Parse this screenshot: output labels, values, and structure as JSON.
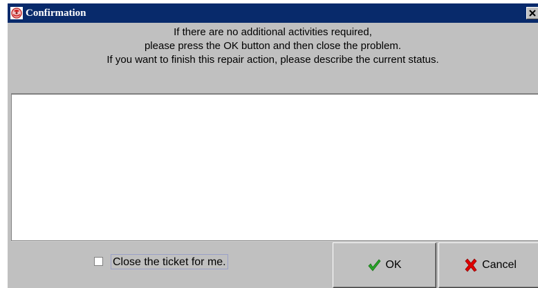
{
  "window": {
    "title": "Confirmation",
    "title_bar_color": "#0a246a",
    "background_color": "#c0c0c0",
    "app_icon": "app-logo-icon",
    "close_icon": "close-icon"
  },
  "message": {
    "line1": "If there are no additional activities required,",
    "line2": "please press the OK button and then close the problem.",
    "line3": "If you want to finish this repair action, please describe the current status."
  },
  "status_field": {
    "value": "",
    "placeholder": ""
  },
  "close_ticket": {
    "label": "Close the ticket for me.",
    "checked": false
  },
  "buttons": {
    "ok": {
      "label": "OK",
      "icon": "checkmark-icon",
      "icon_color": "#2aa52a"
    },
    "cancel": {
      "label": "Cancel",
      "icon": "x-mark-icon",
      "icon_color": "#e00000"
    }
  }
}
